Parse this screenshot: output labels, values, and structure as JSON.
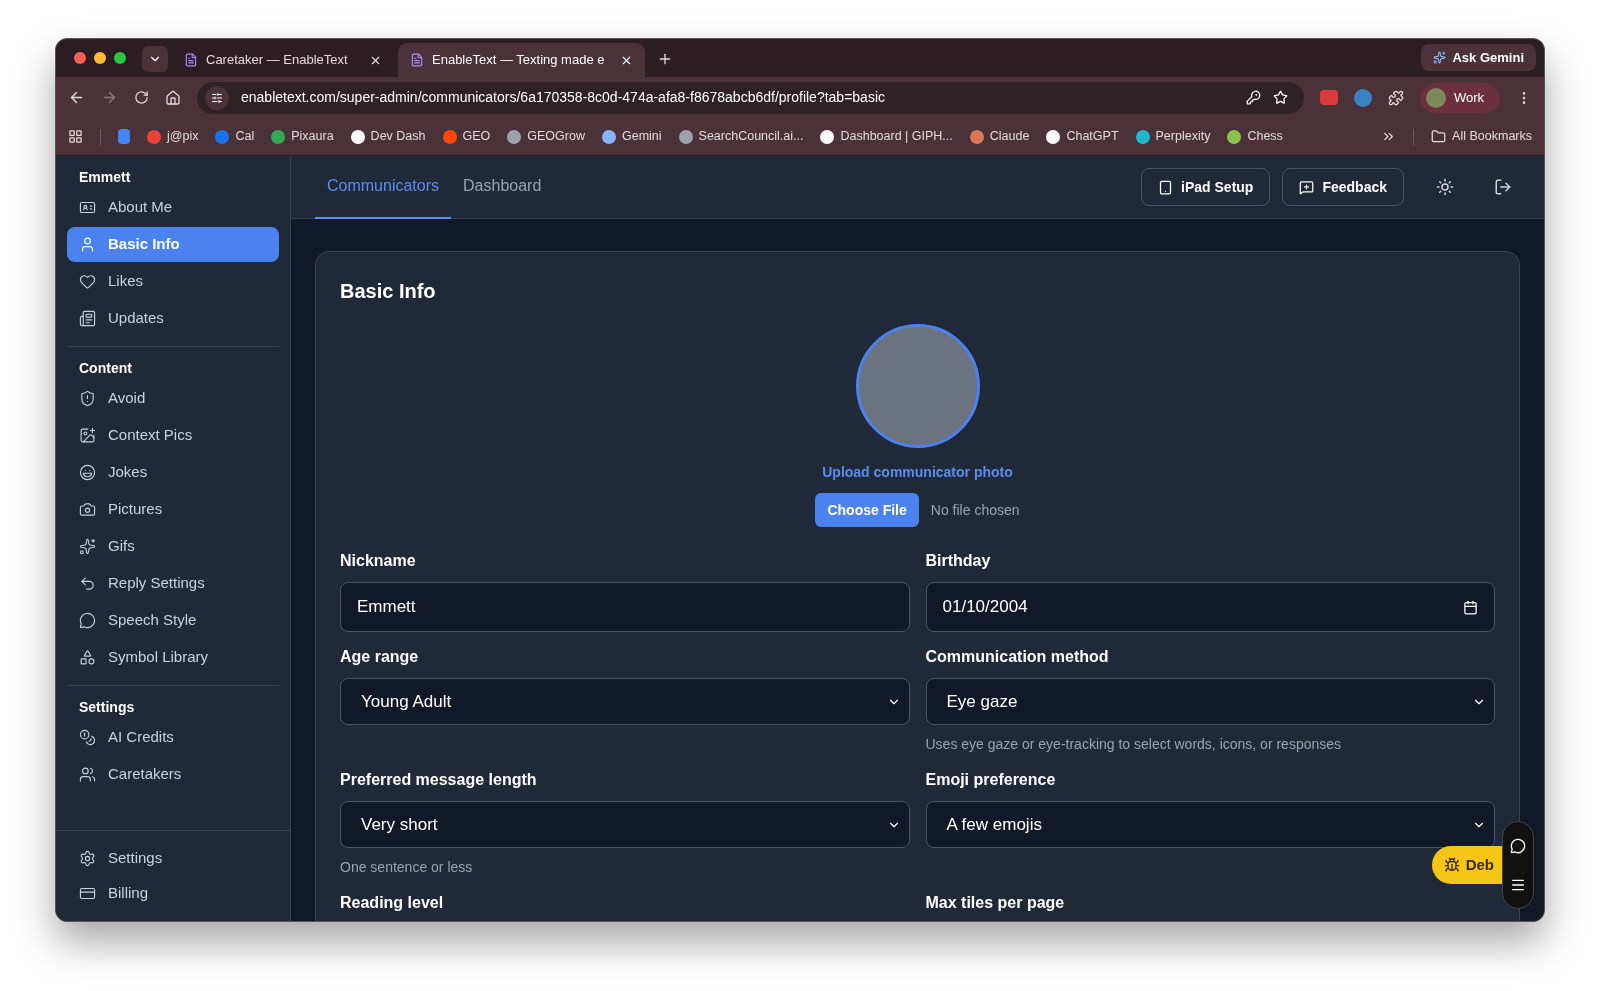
{
  "browser": {
    "tabs": [
      {
        "title": "Caretaker — EnableText",
        "selected": false
      },
      {
        "title": "EnableText — Texting made e",
        "selected": true
      }
    ],
    "ask_gemini": "Ask Gemini",
    "address": "enabletext.com/super-admin/communicators/6a170358-8c0d-474a-afa8-f8678abcb6df/profile?tab=basic",
    "profile": "Work",
    "bookmarks": [
      {
        "label": "j@pix"
      },
      {
        "label": "Cal"
      },
      {
        "label": "Pixaura"
      },
      {
        "label": "Dev Dash"
      },
      {
        "label": "GEO"
      },
      {
        "label": "GEOGrow"
      },
      {
        "label": "Gemini"
      },
      {
        "label": "SearchCouncil.ai..."
      },
      {
        "label": "Dashboard | GIPH..."
      },
      {
        "label": "Claude"
      },
      {
        "label": "ChatGPT"
      },
      {
        "label": "Perplexity"
      },
      {
        "label": "Chess"
      }
    ],
    "all_bookmarks": "All Bookmarks"
  },
  "sidebar": {
    "sections": [
      {
        "heading": "Emmett",
        "items": [
          {
            "label": "About Me",
            "selected": false
          },
          {
            "label": "Basic Info",
            "selected": true
          },
          {
            "label": "Likes",
            "selected": false
          },
          {
            "label": "Updates",
            "selected": false
          }
        ]
      },
      {
        "heading": "Content",
        "items": [
          {
            "label": "Avoid",
            "selected": false
          },
          {
            "label": "Context Pics",
            "selected": false
          },
          {
            "label": "Jokes",
            "selected": false
          },
          {
            "label": "Pictures",
            "selected": false
          },
          {
            "label": "Gifs",
            "selected": false
          },
          {
            "label": "Reply Settings",
            "selected": false
          },
          {
            "label": "Speech Style",
            "selected": false
          },
          {
            "label": "Symbol Library",
            "selected": false
          }
        ]
      },
      {
        "heading": "Settings",
        "items": [
          {
            "label": "AI Credits",
            "selected": false
          },
          {
            "label": "Caretakers",
            "selected": false
          }
        ]
      }
    ],
    "footer_items": [
      {
        "label": "Settings",
        "selected": false
      },
      {
        "label": "Billing",
        "selected": false
      }
    ]
  },
  "nav": {
    "tabs": [
      {
        "label": "Communicators",
        "selected": true
      },
      {
        "label": "Dashboard",
        "selected": false
      }
    ],
    "buttons": [
      "iPad Setup",
      "Feedback"
    ]
  },
  "form": {
    "title": "Basic Info",
    "upload_link": "Upload communicator photo",
    "file_button": "Choose File",
    "file_status": "No file chosen",
    "fields": [
      {
        "label": "Nickname",
        "kind": "text",
        "value": "Emmett"
      },
      {
        "label": "Birthday",
        "kind": "date",
        "value": "01/10/2004"
      },
      {
        "label": "Age range",
        "kind": "select",
        "value": "Young Adult"
      },
      {
        "label": "Communication method",
        "kind": "select",
        "value": "Eye gaze",
        "helper": "Uses eye gaze or eye-tracking to select words, icons, or responses"
      },
      {
        "label": "Preferred message length",
        "kind": "select",
        "value": "Very short",
        "helper": "One sentence or less"
      },
      {
        "label": "Emoji preference",
        "kind": "select",
        "value": "A few emojis"
      },
      {
        "label": "Reading level",
        "kind": "label"
      },
      {
        "label": "Max tiles per page",
        "kind": "label"
      }
    ]
  },
  "debug_button": "Deb"
}
